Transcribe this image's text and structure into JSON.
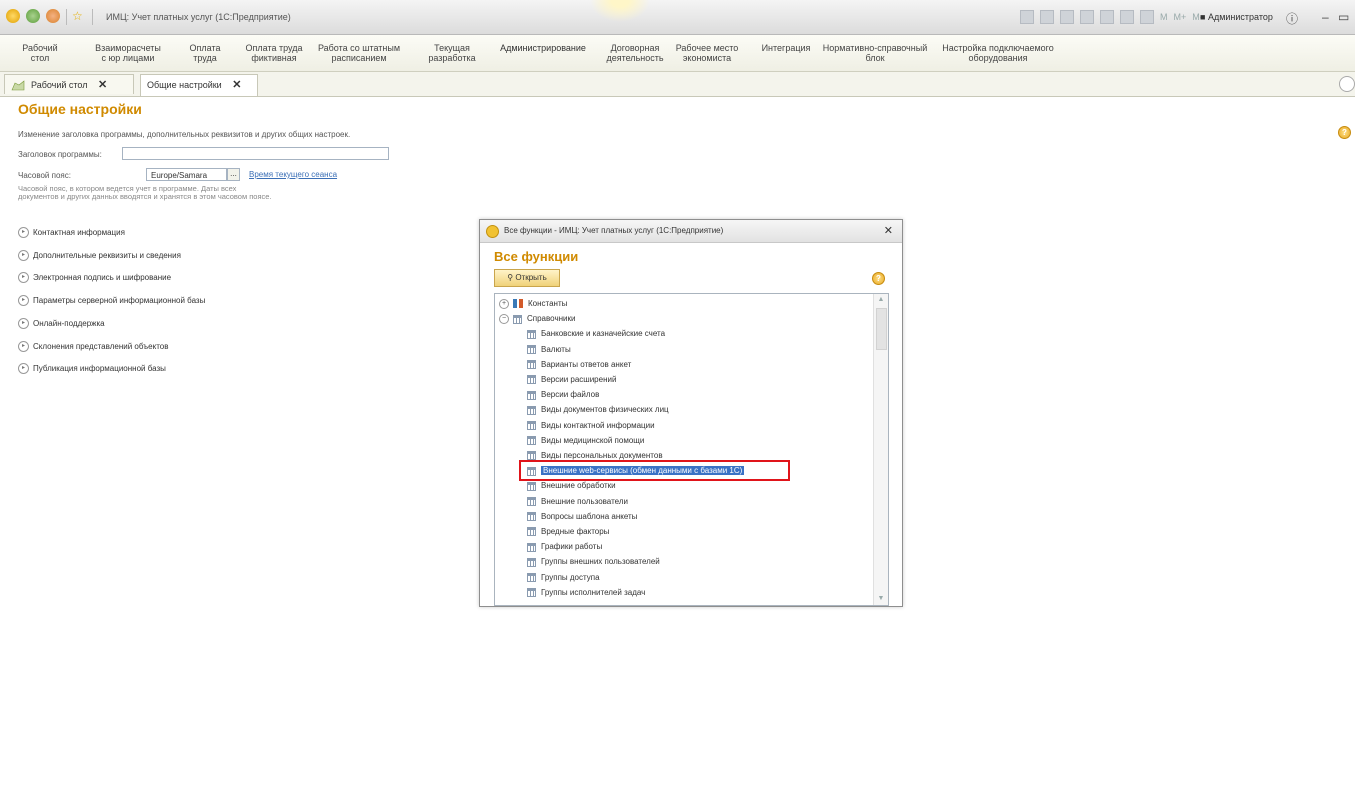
{
  "window": {
    "title": "ИМЦ: Учет платных услуг  (1С:Предприятие)",
    "user": "Администратор",
    "memory_buttons": [
      "M",
      "M+",
      "M-"
    ]
  },
  "sections": [
    {
      "label": "Рабочий\nстол"
    },
    {
      "label": "Взаиморасчеты\nс юр лицами"
    },
    {
      "label": "Оплата\nтруда"
    },
    {
      "label": "Оплата труда\nфиктивная"
    },
    {
      "label": "Работа со штатным\nрасписанием"
    },
    {
      "label": "Текущая\nразработка"
    },
    {
      "label": "Администрирование"
    },
    {
      "label": "Договорная\nдеятельность"
    },
    {
      "label": "Рабочее место\nэкономиста"
    },
    {
      "label": "Интеграция"
    },
    {
      "label": "Нормативно-справочный\nблок"
    },
    {
      "label": "Настройка подключаемого\nоборудования"
    }
  ],
  "tabs": [
    {
      "label": "Рабочий стол"
    },
    {
      "label": "Общие настройки"
    }
  ],
  "form": {
    "title": "Общие настройки",
    "description": "Изменение заголовка программы, дополнительных реквизитов и других общих настроек.",
    "program_title_label": "Заголовок программы:",
    "program_title_value": "",
    "timezone_label": "Часовой пояс:",
    "timezone_value": "Europe/Samara",
    "dots": "...",
    "session_time_link": "Время текущего сеанса",
    "timezone_hint": "Часовой пояс, в котором ведется учет в программе. Даты всех документов и других данных вводятся и хранятся в этом часовом поясе.",
    "groups": [
      "Контактная информация",
      "Дополнительные реквизиты и сведения",
      "Электронная подпись и шифрование",
      "Параметры серверной информационной базы",
      "Онлайн-поддержка",
      "Склонения представлений объектов",
      "Публикация информационной базы"
    ]
  },
  "dialog": {
    "title": "Все функции - ИМЦ: Учет платных услуг  (1С:Предприятие)",
    "heading": "Все функции",
    "open_button": "Открыть",
    "tree": [
      {
        "label": "Константы",
        "level": 0,
        "expander": "+",
        "icon": "const"
      },
      {
        "label": "Справочники",
        "level": 0,
        "expander": "−",
        "icon": "catalog"
      },
      {
        "label": "Банковские и казначейские счета",
        "level": 1,
        "icon": "catalog"
      },
      {
        "label": "Валюты",
        "level": 1,
        "icon": "catalog"
      },
      {
        "label": "Варианты ответов анкет",
        "level": 1,
        "icon": "catalog"
      },
      {
        "label": "Версии расширений",
        "level": 1,
        "icon": "catalog"
      },
      {
        "label": "Версии файлов",
        "level": 1,
        "icon": "catalog"
      },
      {
        "label": "Виды документов физических лиц",
        "level": 1,
        "icon": "catalog"
      },
      {
        "label": "Виды контактной информации",
        "level": 1,
        "icon": "catalog"
      },
      {
        "label": "Виды медицинской помощи",
        "level": 1,
        "icon": "catalog"
      },
      {
        "label": "Виды персональных документов",
        "level": 1,
        "icon": "catalog"
      },
      {
        "label": "Внешние web-сервисы (обмен данными с базами 1С)",
        "level": 1,
        "icon": "catalog",
        "selected": true
      },
      {
        "label": "Внешние обработки",
        "level": 1,
        "icon": "catalog"
      },
      {
        "label": "Внешние пользователи",
        "level": 1,
        "icon": "catalog"
      },
      {
        "label": "Вопросы шаблона анкеты",
        "level": 1,
        "icon": "catalog"
      },
      {
        "label": "Вредные факторы",
        "level": 1,
        "icon": "catalog"
      },
      {
        "label": "Графики работы",
        "level": 1,
        "icon": "catalog"
      },
      {
        "label": "Группы внешних пользователей",
        "level": 1,
        "icon": "catalog"
      },
      {
        "label": "Группы доступа",
        "level": 1,
        "icon": "catalog"
      },
      {
        "label": "Группы исполнителей задач",
        "level": 1,
        "icon": "catalog"
      }
    ]
  }
}
